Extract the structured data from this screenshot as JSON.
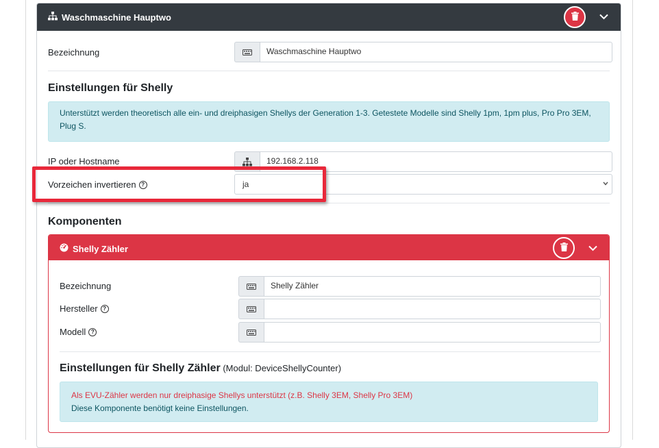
{
  "device": {
    "title": "Waschmaschine Hauptwo",
    "bezeichnung_label": "Bezeichnung",
    "bezeichnung_value": "Waschmaschine Hauptwo",
    "settings_title": "Einstellungen für Shelly",
    "info_text": "Unterstützt werden theoretisch alle ein- und dreiphasigen Shellys der Generation 1-3. Getestete Modelle sind Shelly 1pm, 1pm plus, Pro Pro 3EM, Plug S.",
    "ip_label": "IP oder Hostname",
    "ip_value": "192.168.2.118",
    "invert_label": "Vorzeichen invertieren",
    "invert_value": "ja",
    "components_title": "Komponenten"
  },
  "component": {
    "title": "Shelly Zähler",
    "bezeichnung_label": "Bezeichnung",
    "bezeichnung_value": "Shelly Zähler",
    "hersteller_label": "Hersteller",
    "hersteller_value": "",
    "modell_label": "Modell",
    "modell_value": "",
    "settings_title": "Einstellungen für Shelly Zähler",
    "settings_module": "(Modul: DeviceShellyCounter)",
    "warning_text": "Als EVU-Zähler werden nur dreiphasige Shellys unterstützt (z.B. Shelly 3EM, Shelly Pro 3EM)",
    "note_text": "Diese Komponente benötigt keine Einstellungen."
  },
  "icons": {
    "network": "network-icon",
    "keyboard": "keyboard-icon",
    "trash": "trash-icon",
    "chevron": "chevron-down-icon",
    "gauge": "gauge-icon",
    "help": "question-circle-icon"
  },
  "colors": {
    "header_dark": "#343a40",
    "danger": "#dc3545",
    "info_bg": "#d1ecf1",
    "info_text": "#0c5460",
    "highlight": "#e8283a"
  }
}
